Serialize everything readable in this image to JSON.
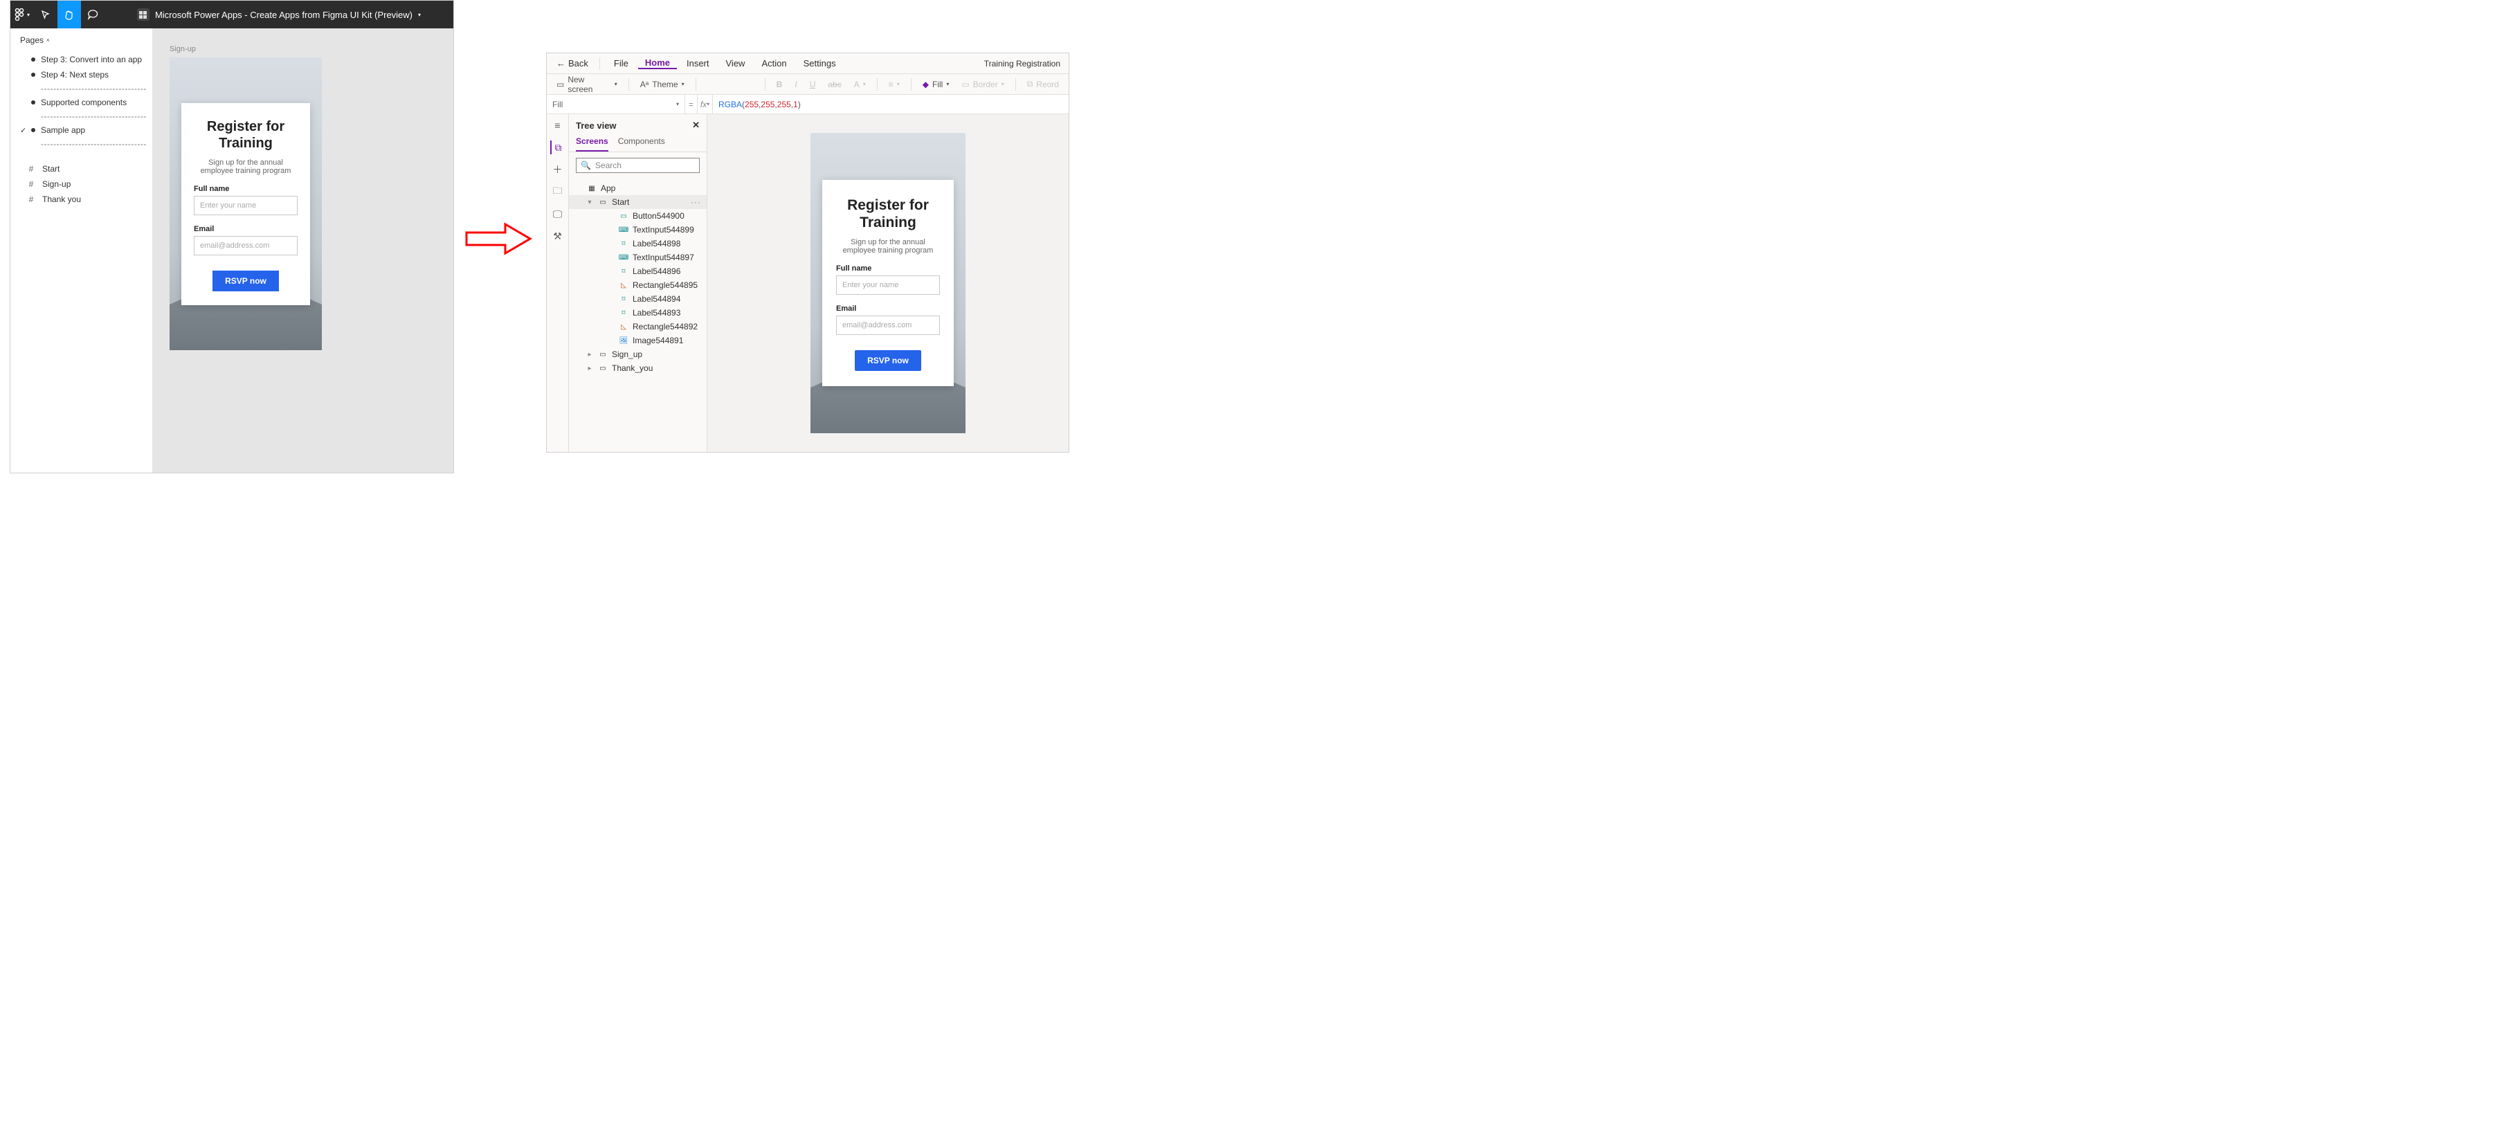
{
  "figma": {
    "title": "Microsoft Power Apps - Create Apps from Figma UI Kit (Preview)",
    "pagesHeader": "Pages",
    "pageItems": {
      "step3": "Step 3: Convert into an app",
      "step4": "Step 4: Next steps",
      "supported": "Supported components",
      "sample": "Sample app"
    },
    "dashes": "----------------------------------",
    "frames": {
      "start": "Start",
      "signup": "Sign-up",
      "thankyou": "Thank you"
    },
    "canvas": {
      "frameLabel": "Sign-up"
    }
  },
  "form": {
    "title1": "Register for",
    "title2": "Training",
    "subtitle": "Sign up for the annual employee training program",
    "fullNameLabel": "Full name",
    "fullNamePlaceholder": "Enter your name",
    "emailLabel": "Email",
    "emailPlaceholder": "email@address.com",
    "rsvp": "RSVP now"
  },
  "pa": {
    "back": "Back",
    "menu": {
      "file": "File",
      "home": "Home",
      "insert": "Insert",
      "view": "View",
      "action": "Action",
      "settings": "Settings"
    },
    "appTitle": "Training Registration",
    "ribbon": {
      "newScreen": "New screen",
      "theme": "Theme",
      "fill": "Fill",
      "border": "Border",
      "reord": "Reord"
    },
    "property": "Fill",
    "formula": {
      "fn": "RGBA",
      "open": "(",
      "a": "255",
      "c1": ", ",
      "b": "255",
      "c2": ", ",
      "c": "255",
      "c3": ", ",
      "d": "1",
      "close": ")"
    },
    "tree": {
      "header": "Tree view",
      "tabScreens": "Screens",
      "tabComponents": "Components",
      "search": "Search",
      "app": "App",
      "start": "Start",
      "signup": "Sign_up",
      "thankyou": "Thank_you",
      "nodes": {
        "n0": "Button544900",
        "n1": "TextInput544899",
        "n2": "Label544898",
        "n3": "TextInput544897",
        "n4": "Label544896",
        "n5": "Rectangle544895",
        "n6": "Label544894",
        "n7": "Label544893",
        "n8": "Rectangle544892",
        "n9": "Image544891"
      }
    }
  }
}
